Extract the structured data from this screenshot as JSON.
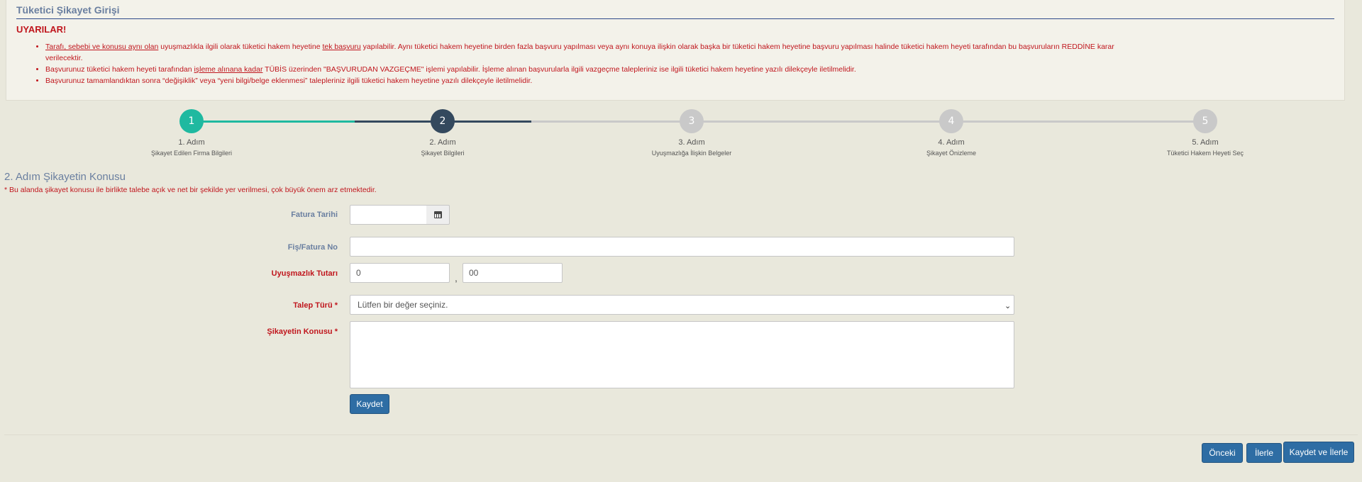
{
  "panel": {
    "title": "Tüketici Şikayet Girişi",
    "warnings_title": "UYARILAR!",
    "warnings": [
      {
        "u1": "Tarafı, sebebi ve konusu aynı olan",
        "t1": " uyuşmazlıkla ilgili olarak tüketici hakem heyetine ",
        "u2": "tek başvuru",
        "t2": " yapılabilir. Aynı tüketici hakem heyetine birden fazla başvuru yapılması veya aynı konuya ilişkin olarak başka bir tüketici hakem heyetine başvuru yapılması halinde tüketici hakem heyeti tarafından bu başvuruların REDDİNE karar verilecektir."
      },
      {
        "t0": "Başvurunuz tüketici hakem heyeti tarafından ",
        "u1": "işleme alınana kadar",
        "t1": " TÜBİS üzerinden \"BAŞVURUDAN VAZGEÇME\" işlemi yapılabilir. İşleme alınan başvurularla ilgili vazgeçme talepleriniz ise ilgili tüketici hakem heyetine yazılı dilekçeyle iletilmelidir."
      },
      {
        "t0": "Başvurunuz tamamlandıktan sonra “değişiklik” veya “yeni bilgi/belge eklenmesi” talepleriniz ilgili tüketici hakem heyetine yazılı dilekçeyle iletilmelidir."
      }
    ]
  },
  "steps": [
    {
      "num": "1",
      "title": "1. Adım",
      "sub": "Şikayet Edilen Firma Bilgileri",
      "state": "done"
    },
    {
      "num": "2",
      "title": "2. Adım",
      "sub": "Şikayet Bilgileri",
      "state": "active"
    },
    {
      "num": "3",
      "title": "3. Adım",
      "sub": "Uyuşmazlığa İlişkin Belgeler",
      "state": "pending"
    },
    {
      "num": "4",
      "title": "4. Adım",
      "sub": "Şikayet Önizleme",
      "state": "pending"
    },
    {
      "num": "5",
      "title": "5. Adım",
      "sub": "Tüketici Hakem Heyeti Seç",
      "state": "pending"
    }
  ],
  "section": {
    "title": "2. Adım Şikayetin Konusu",
    "note": "* Bu alanda şikayet konusu ile birlikte talebe açık ve net bir şekilde yer verilmesi, çok büyük önem arz etmektedir."
  },
  "form": {
    "invoice_date_label": "Fatura Tarihi",
    "invoice_date_value": "",
    "invoice_no_label": "Fiş/Fatura No",
    "invoice_no_value": "",
    "amount_label": "Uyuşmazlık Tutarı",
    "amount_whole": "0",
    "amount_comma": ",",
    "amount_decimal": "00",
    "request_type_label": "Talep Türü *",
    "request_type_selected": "Lütfen bir değer seçiniz.",
    "complaint_label": "Şikayetin Konusu *",
    "complaint_value": "",
    "save_label": "Kaydet"
  },
  "footer": {
    "prev_label": "Önceki",
    "next_label": "İlerle",
    "save_next_label": "Kaydet ve İlerle"
  },
  "colors": {
    "accent_blue": "#2e6da4",
    "step_done": "#1fb9a0",
    "step_active": "#34495e",
    "warning_red": "#c0161d"
  }
}
